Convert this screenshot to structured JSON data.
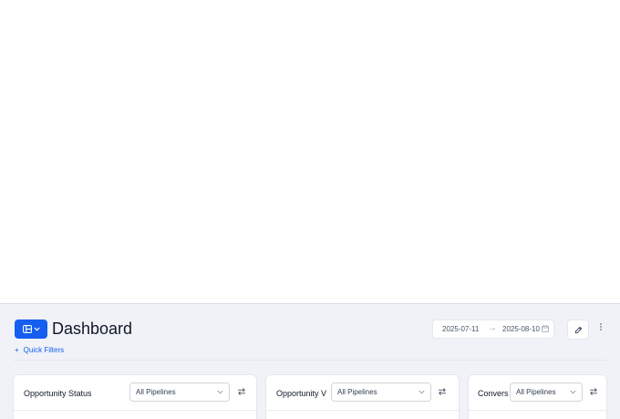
{
  "header": {
    "title": "Dashboard"
  },
  "date_range": {
    "start": "2025-07-11",
    "end": "2025-08-10"
  },
  "quick_filters": {
    "icon": "+",
    "label": "Quick Filters"
  },
  "cards": [
    {
      "title": "Opportunity Status",
      "pipeline_value": "All Pipelines"
    },
    {
      "title": "Opportunity V",
      "pipeline_value": "All Pipelines"
    },
    {
      "title": "Convers",
      "pipeline_value": "All Pipelines"
    }
  ],
  "colors": {
    "accent": "#155eef",
    "background": "#f0f2f7",
    "card": "#ffffff"
  }
}
